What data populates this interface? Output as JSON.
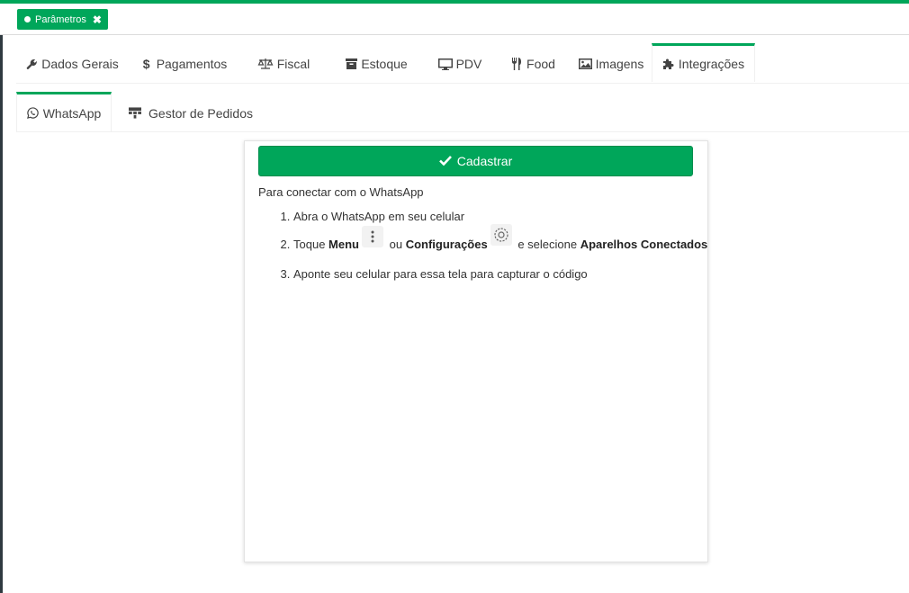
{
  "window_tab": {
    "label": "Parâmetros",
    "close_icon": "times-icon"
  },
  "main_tabs": [
    {
      "label": "Dados Gerais",
      "icon": "wrench-icon"
    },
    {
      "label": "Pagamentos",
      "icon": "dollar-icon"
    },
    {
      "label": "Fiscal",
      "icon": "balance-scale-icon"
    },
    {
      "label": "Estoque",
      "icon": "archive-icon"
    },
    {
      "label": "PDV",
      "icon": "desktop-icon"
    },
    {
      "label": "Food",
      "icon": "cutlery-icon"
    },
    {
      "label": "Imagens",
      "icon": "image-icon"
    },
    {
      "label": "Integrações",
      "icon": "puzzle-icon",
      "active": true
    }
  ],
  "sub_tabs": [
    {
      "label": "WhatsApp",
      "icon": "whatsapp-icon",
      "active": true
    },
    {
      "label": "Gestor de Pedidos",
      "icon": "sitemap-icon"
    }
  ],
  "card": {
    "register_button": "Cadastrar",
    "intro": "Para conectar com o WhatsApp",
    "steps": {
      "s1": "Abra o WhatsApp em seu celular",
      "s2_a": "Toque ",
      "s2_menu": "Menu",
      "s2_b": " ou ",
      "s2_config": "Configurações",
      "s2_c": " e selecione ",
      "s2_devices": "Aparelhos Conectados",
      "s3": "Aponte seu celular para essa tela para capturar o código"
    }
  },
  "colors": {
    "accent": "#00a65a",
    "accent_dark": "#008d4c"
  }
}
